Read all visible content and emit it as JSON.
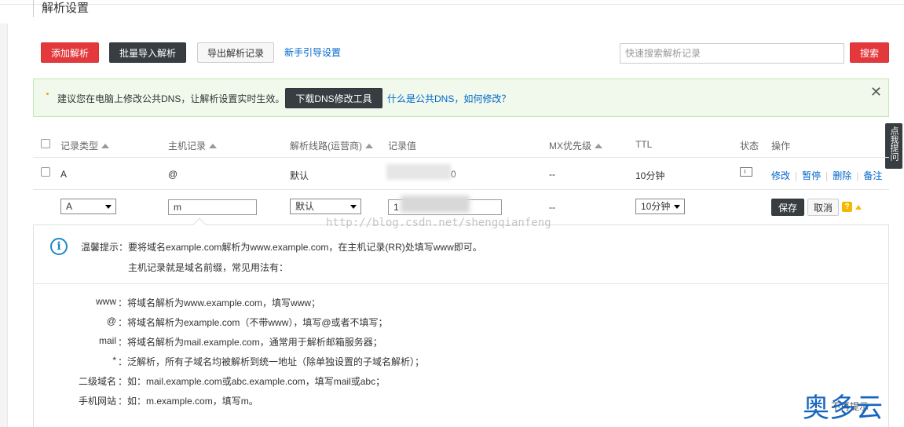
{
  "page": {
    "title": "解析设置"
  },
  "toolbar": {
    "add_label": "添加解析",
    "batch_import_label": "批量导入解析",
    "export_label": "导出解析记录",
    "guide_link": "新手引导设置",
    "search_placeholder": "快速搜索解析记录",
    "search_button": "搜索"
  },
  "notice": {
    "text": "建议您在电脑上修改公共DNS，让解析设置实时生效。",
    "download_button": "下载DNS修改工具",
    "help_link": "什么是公共DNS，如何修改？",
    "close": "✕"
  },
  "side_tab": {
    "label": "点我提问"
  },
  "table": {
    "headers": {
      "type": "记录类型",
      "host": "主机记录",
      "line": "解析线路(运营商)",
      "value": "记录值",
      "mx": "MX优先级",
      "ttl": "TTL",
      "status": "状态",
      "ops": "操作"
    },
    "row": {
      "type": "A",
      "host": "@",
      "line": "默认",
      "value_tail": "0",
      "mx": "--",
      "ttl": "10分钟",
      "ops": [
        "修改",
        "暂停",
        "删除",
        "备注"
      ]
    },
    "edit_row": {
      "type": "A",
      "host": "m",
      "line": "默认",
      "value_prefix": "1",
      "mx": "--",
      "ttl": "10分钟",
      "save": "保存",
      "cancel": "取消",
      "help": "?"
    }
  },
  "tip": {
    "label": "温馨提示：",
    "line1": "要将域名example.com解析为www.example.com，在主机记录(RR)处填写www即可。",
    "line2": "主机记录就是域名前缀，常见用法有：",
    "examples": [
      {
        "key": "www",
        "value": "：将域名解析为www.example.com，填写www；"
      },
      {
        "key": "@",
        "value": "：将域名解析为example.com（不带www），填写@或者不填写；"
      },
      {
        "key": "mail",
        "value": "：将域名解析为mail.example.com，通常用于解析邮箱服务器；"
      },
      {
        "key": "*",
        "value": "：泛解析，所有子域名均被解析到统一地址（除单独设置的子域名解析）；"
      },
      {
        "key": "二级域名",
        "value": "：如：mail.example.com或abc.example.com，填写mail或abc；"
      },
      {
        "key": "手机网站",
        "value": "：如：m.example.com，填写m。"
      }
    ]
  },
  "watermark": "http://blog.csdn.net/shengqianfeng",
  "brand": {
    "name": "奥多云",
    "overlay": "不再提示"
  },
  "colors": {
    "red": "#e4393c",
    "dark": "#373d41",
    "link": "#0066cc",
    "notice_bg": "#f0f9eb",
    "info": "#1e88c8",
    "warn": "#f5b800"
  }
}
